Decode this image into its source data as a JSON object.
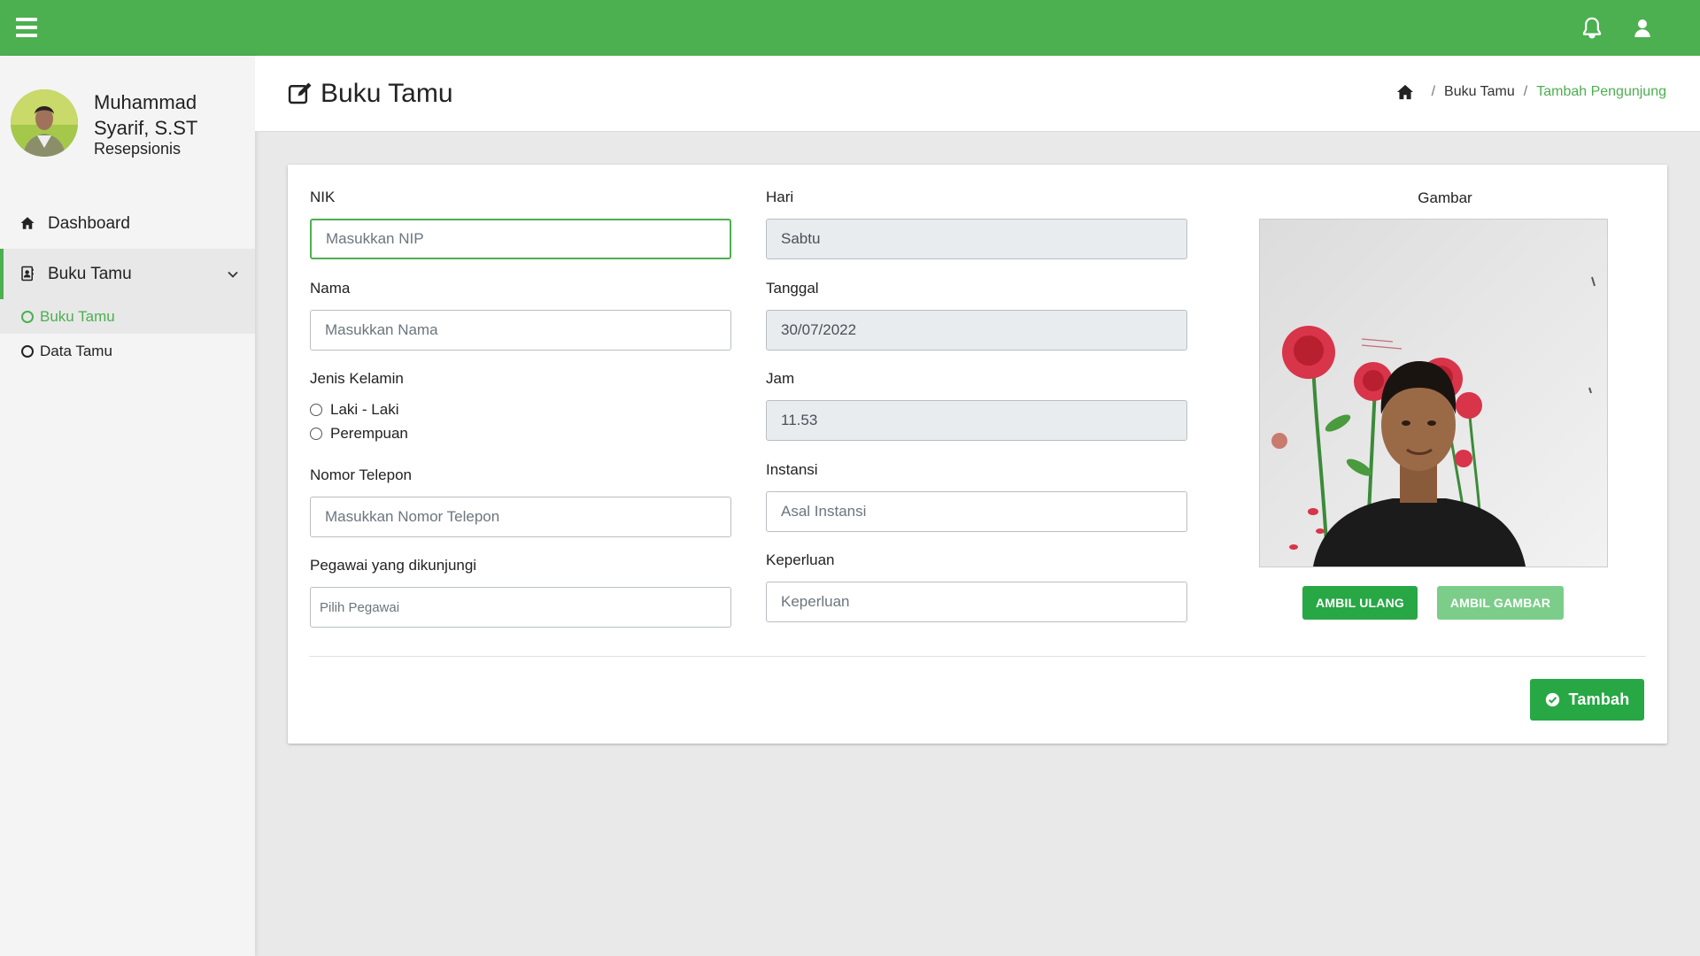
{
  "colors": {
    "primary": "#4caf50",
    "button_green": "#28a745",
    "button_green_disabled": "#7ccd8a"
  },
  "topbar": {
    "menu_icon": "hamburger-icon",
    "notification_icon": "bell-icon",
    "user_icon": "user-icon"
  },
  "sidebar": {
    "user": {
      "name": "Muhammad Syarif, S.ST",
      "role": "Resepsionis"
    },
    "items": [
      {
        "label": "Dashboard",
        "icon": "home-icon"
      },
      {
        "label": "Buku Tamu",
        "icon": "address-book-icon",
        "expanded": true,
        "children": [
          {
            "label": "Buku Tamu",
            "current": true
          },
          {
            "label": "Data Tamu",
            "current": false
          }
        ]
      }
    ]
  },
  "header": {
    "title": "Buku Tamu",
    "breadcrumb": [
      "Buku Tamu",
      "Tambah Pengunjung"
    ]
  },
  "form": {
    "nik": {
      "label": "NIK",
      "placeholder": "Masukkan NIP",
      "value": ""
    },
    "nama": {
      "label": "Nama",
      "placeholder": "Masukkan Nama",
      "value": ""
    },
    "jenis_kelamin": {
      "label": "Jenis Kelamin",
      "options": [
        "Laki - Laki",
        "Perempuan"
      ],
      "selected": null
    },
    "telepon": {
      "label": "Nomor Telepon",
      "placeholder": "Masukkan Nomor Telepon",
      "value": ""
    },
    "pegawai": {
      "label": "Pegawai yang dikunjungi",
      "placeholder": "Pilih Pegawai",
      "value": ""
    },
    "hari": {
      "label": "Hari",
      "value": "Sabtu"
    },
    "tanggal": {
      "label": "Tanggal",
      "value": "30/07/2022"
    },
    "jam": {
      "label": "Jam",
      "value": "11.53"
    },
    "instansi": {
      "label": "Instansi",
      "placeholder": "Asal Instansi",
      "value": ""
    },
    "keperluan": {
      "label": "Keperluan",
      "placeholder": "Keperluan",
      "value": ""
    },
    "gambar": {
      "label": "Gambar"
    }
  },
  "buttons": {
    "retake": "AMBIL ULANG",
    "capture": "AMBIL GAMBAR",
    "submit": "Tambah"
  }
}
